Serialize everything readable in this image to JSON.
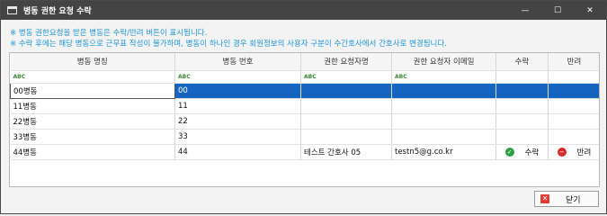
{
  "window": {
    "title": "병동 권한 요청 수락",
    "minimize": "—",
    "maximize": "☐",
    "close": "✕"
  },
  "notices": [
    "※ 병동 권한요청을 받은 병동은 수락/반려 버튼이 표시됩니다.",
    "※ 수락 후에는 해당 병동으로 근무표 작성이 불가하며, 병동이 하나인 경우 회원정보의 사용자 구분이 수간호사에서 간호사로 변경됩니다."
  ],
  "grid": {
    "columns": [
      "병동 명칭",
      "병동 번호",
      "권한 요청자명",
      "권한 요청자 이메일",
      "수락",
      "반려"
    ],
    "filter_icon": "ABC",
    "rows": [
      {
        "name": "00병동",
        "number": "00",
        "requester": "",
        "email": "",
        "accept": "",
        "reject": ""
      },
      {
        "name": "11병동",
        "number": "11",
        "requester": "",
        "email": "",
        "accept": "",
        "reject": ""
      },
      {
        "name": "22병동",
        "number": "22",
        "requester": "",
        "email": "",
        "accept": "",
        "reject": ""
      },
      {
        "name": "33병동",
        "number": "33",
        "requester": "",
        "email": "",
        "accept": "",
        "reject": ""
      },
      {
        "name": "44병동",
        "number": "44",
        "requester": "테스트 간호사 05",
        "email": "testn5@g.co.kr",
        "accept": "수락",
        "reject": "반려"
      }
    ]
  },
  "icons": {
    "accept": "check-circle-icon",
    "reject": "minus-circle-icon",
    "close": "x-box-icon"
  },
  "colors": {
    "selection": "#1565c0",
    "notice": "#2196d6",
    "accept": "#2f9e44",
    "reject": "#d42a2a"
  },
  "footer": {
    "close_label": "닫기"
  }
}
